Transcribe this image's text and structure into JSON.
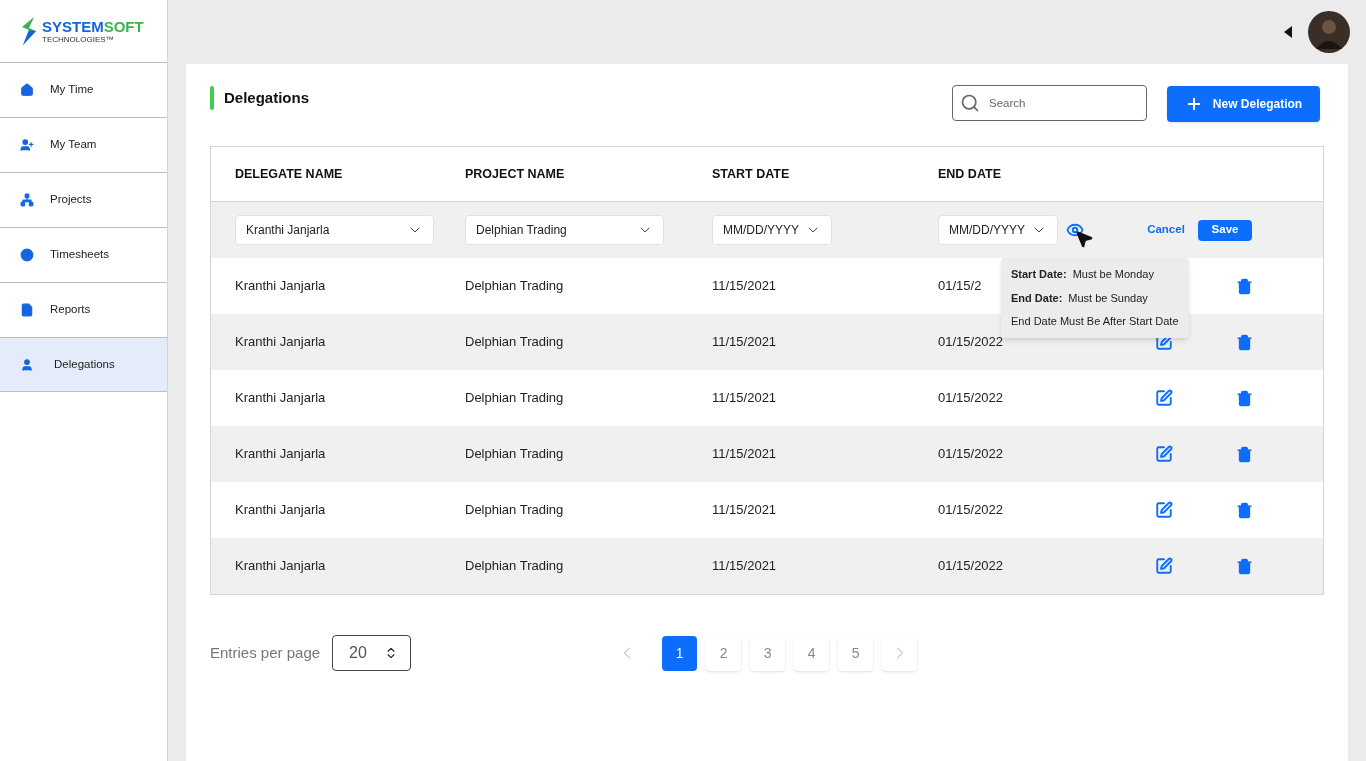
{
  "logo": {
    "part1": "SYSTEM",
    "part2": "SOFT",
    "tagline": "TECHNOLOGIES™"
  },
  "sidebar": {
    "items": [
      {
        "label": "My Time",
        "selected": false
      },
      {
        "label": "My Team",
        "selected": false
      },
      {
        "label": "Projects",
        "selected": false
      },
      {
        "label": "Timesheets",
        "selected": false
      },
      {
        "label": "Reports",
        "selected": false
      },
      {
        "label": "Delegations",
        "selected": true
      }
    ]
  },
  "page": {
    "title": "Delegations"
  },
  "search": {
    "placeholder": "Search"
  },
  "new_button": "New Delegation",
  "table": {
    "columns": [
      "DELEGATE NAME",
      "PROJECT NAME",
      "START DATE",
      "END DATE"
    ],
    "edit_row": {
      "delegate": "Kranthi Janjarla",
      "project": "Delphian Trading",
      "start": "MM/DD/YYYY",
      "end": "MM/DD/YYYY",
      "cancel": "Cancel",
      "save": "Save"
    },
    "rows": [
      {
        "cells": [
          "Kranthi Janjarla",
          "Delphian Trading",
          "11/15/2021",
          "01/15/2"
        ],
        "actions": [
          {
            "kind": "delete"
          }
        ]
      },
      {
        "cells": [
          "Kranthi Janjarla",
          "Delphian Trading",
          "11/15/2021",
          "01/15/2022"
        ],
        "actions": [
          {
            "kind": "edit"
          },
          {
            "kind": "delete"
          }
        ]
      },
      {
        "cells": [
          "Kranthi Janjarla",
          "Delphian Trading",
          "11/15/2021",
          "01/15/2022"
        ],
        "actions": [
          {
            "kind": "edit"
          },
          {
            "kind": "delete"
          }
        ]
      },
      {
        "cells": [
          "Kranthi Janjarla",
          "Delphian Trading",
          "11/15/2021",
          "01/15/2022"
        ],
        "actions": [
          {
            "kind": "edit"
          },
          {
            "kind": "delete"
          }
        ]
      },
      {
        "cells": [
          "Kranthi Janjarla",
          "Delphian Trading",
          "11/15/2021",
          "01/15/2022"
        ],
        "actions": [
          {
            "kind": "edit"
          },
          {
            "kind": "delete"
          }
        ]
      },
      {
        "cells": [
          "Kranthi Janjarla",
          "Delphian Trading",
          "11/15/2021",
          "01/15/2022"
        ],
        "actions": [
          {
            "kind": "edit"
          },
          {
            "kind": "delete"
          }
        ]
      }
    ]
  },
  "tooltip": {
    "lines": [
      {
        "label": "Start Date:",
        "text": "Must be Monday"
      },
      {
        "label": "End Date:",
        "text": "Must be Sunday"
      },
      {
        "text": "End Date Must Be After Start Date"
      }
    ]
  },
  "pagination": {
    "entries_label": "Entries per page",
    "entries_value": "20",
    "pages": [
      {
        "label": "1",
        "selected": true
      },
      {
        "label": "2",
        "selected": false
      },
      {
        "label": "3",
        "selected": false
      },
      {
        "label": "4",
        "selected": false
      },
      {
        "label": "5",
        "selected": false
      }
    ]
  }
}
